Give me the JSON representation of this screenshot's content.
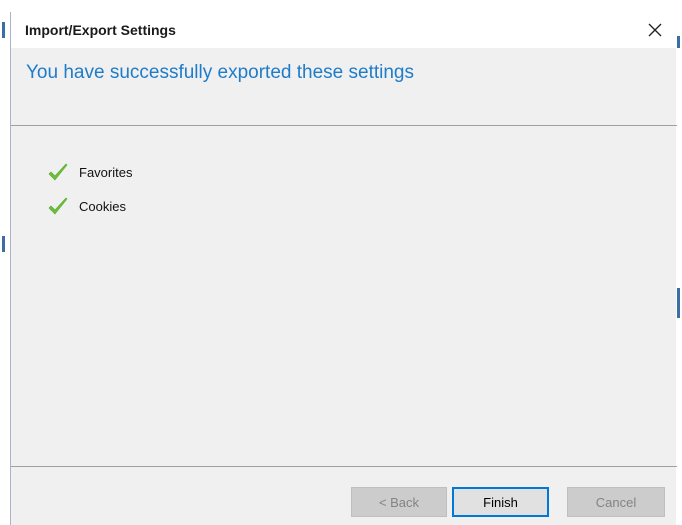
{
  "window": {
    "title": "Import/Export Settings",
    "close_icon": "close-icon"
  },
  "heading": "You have successfully exported these settings",
  "items": [
    {
      "label": "Favorites",
      "icon": "check-icon"
    },
    {
      "label": "Cookies",
      "icon": "check-icon"
    }
  ],
  "buttons": {
    "back": "< Back",
    "finish": "Finish",
    "cancel": "Cancel"
  },
  "colors": {
    "heading": "#1e7cc9",
    "check": "#6cbf3b",
    "accent": "#0078d7"
  }
}
